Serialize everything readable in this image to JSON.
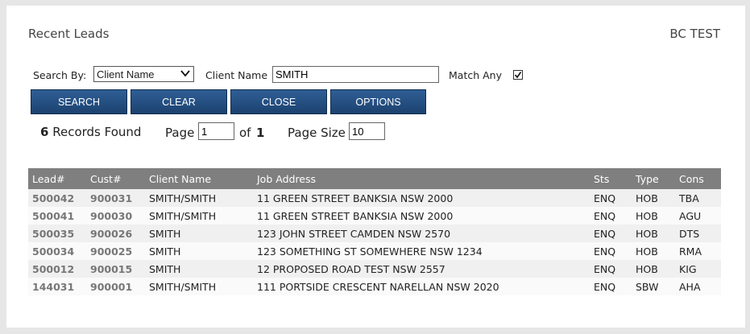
{
  "header": {
    "title": "Recent Leads",
    "account": "BC TEST"
  },
  "search": {
    "by_label": "Search By:",
    "by_value": "Client Name",
    "field_label": "Client Name",
    "field_value": "SMITH",
    "match_any_label": "Match Any",
    "match_any_checked": true
  },
  "buttons": {
    "search": "SEARCH",
    "clear": "CLEAR",
    "close": "CLOSE",
    "options": "OPTIONS"
  },
  "results": {
    "count": "6",
    "records_found": "Records Found",
    "page_label": "Page",
    "page_value": "1",
    "of_label": "of",
    "total_pages": "1",
    "page_size_label": "Page Size",
    "page_size_value": "10"
  },
  "table": {
    "headers": {
      "lead": "Lead#",
      "cust": "Cust#",
      "client": "Client Name",
      "address": "Job Address",
      "sts": "Sts",
      "type": "Type",
      "cons": "Cons"
    },
    "rows": [
      {
        "lead": "500042",
        "cust": "900031",
        "client": "SMITH/SMITH",
        "address": "11 GREEN STREET BANKSIA NSW 2000",
        "sts": "ENQ",
        "type": "HOB",
        "cons": "TBA"
      },
      {
        "lead": "500041",
        "cust": "900030",
        "client": "SMITH/SMITH",
        "address": "11 GREEN STREET BANKSIA NSW 2000",
        "sts": "ENQ",
        "type": "HOB",
        "cons": "AGU"
      },
      {
        "lead": "500035",
        "cust": "900026",
        "client": "SMITH",
        "address": "123 JOHN STREET CAMDEN NSW 2570",
        "sts": "ENQ",
        "type": "HOB",
        "cons": "DTS"
      },
      {
        "lead": "500034",
        "cust": "900025",
        "client": "SMITH",
        "address": "123 SOMETHING ST SOMEWHERE NSW 1234",
        "sts": "ENQ",
        "type": "HOB",
        "cons": "RMA"
      },
      {
        "lead": "500012",
        "cust": "900015",
        "client": "SMITH",
        "address": "12 PROPOSED ROAD TEST NSW 2557",
        "sts": "ENQ",
        "type": "HOB",
        "cons": "KIG"
      },
      {
        "lead": "144031",
        "cust": "900001",
        "client": "SMITH/SMITH",
        "address": "111 PORTSIDE CRESCENT NARELLAN NSW 2020",
        "sts": "ENQ",
        "type": "SBW",
        "cons": "AHA"
      }
    ]
  }
}
